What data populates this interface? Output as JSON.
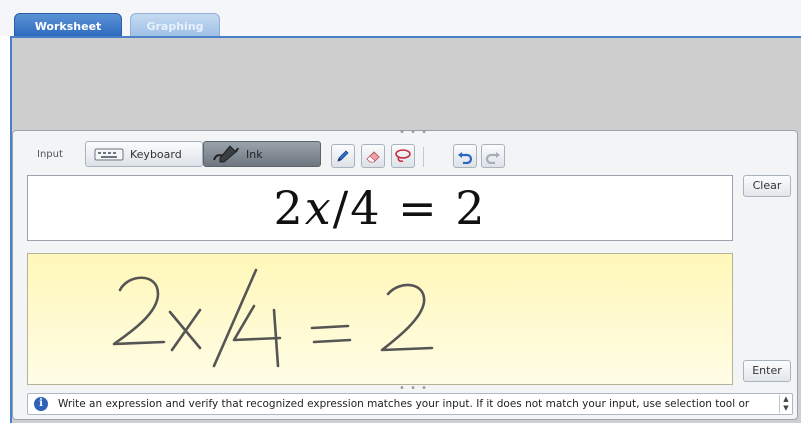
{
  "tabs": [
    {
      "label": "Worksheet",
      "active": true
    },
    {
      "label": "Graphing",
      "active": false
    }
  ],
  "toolbar": {
    "input_label": "Input",
    "keyboard_label": "Keyboard",
    "ink_label": "Ink",
    "tools": [
      "pen-icon",
      "eraser-icon",
      "lasso-select-icon",
      "undo-icon",
      "redo-icon"
    ]
  },
  "display": {
    "expression": "2x/4 = 2",
    "parts": {
      "a": "2",
      "var": "x",
      "b": "/4 = 2"
    }
  },
  "buttons": {
    "clear": "Clear",
    "enter": "Enter"
  },
  "ink_area": {
    "handwriting": "2x/4=2"
  },
  "status": {
    "message": "Write an expression and verify that recognized expression matches your input. If it does not match your input, use selection tool or"
  },
  "colors": {
    "active_tab": "#2f6bbf",
    "ink_background": "#fff7b8",
    "info_icon": "#2e62b8",
    "frame": "#cfcfcf"
  }
}
